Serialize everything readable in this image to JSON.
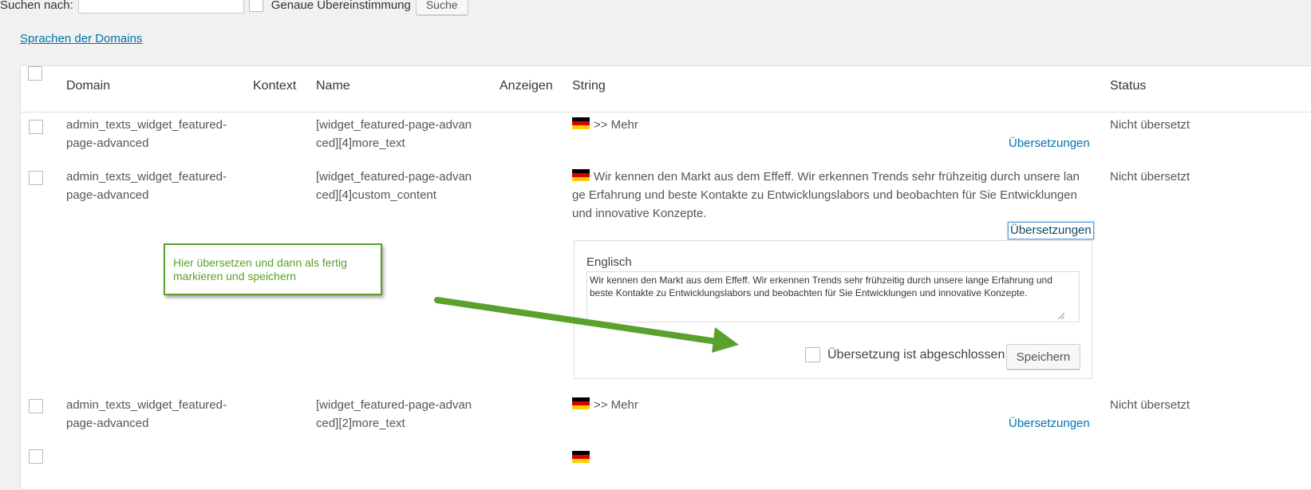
{
  "search": {
    "label": "Suchen nach:",
    "input_value": "",
    "exact_label": "Genaue Übereinstimmung",
    "button_label": "Suche"
  },
  "domain_languages_link": "Sprachen der Domains",
  "table": {
    "headers": {
      "domain": "Domain",
      "context": "Kontext",
      "name": "Name",
      "view": "Anzeigen",
      "string": "String",
      "status": "Status"
    },
    "rows": [
      {
        "domain_line1": "admin_texts_widget_featured-",
        "domain_line2": "page-advanced",
        "name_line1": "[widget_featured-page-advan",
        "name_line2": "ced][4]more_text",
        "string_line1": ">> Mehr",
        "translations_link": "Übersetzungen",
        "status": "Nicht übersetzt"
      },
      {
        "domain_line1": "admin_texts_widget_featured-",
        "domain_line2": "page-advanced",
        "name_line1": "[widget_featured-page-advan",
        "name_line2": "ced][4]custom_content",
        "string_line1": "Wir kennen den Markt aus dem Effeff. Wir erkennen Trends sehr frühzeitig durch unsere lan",
        "string_line2": "ge Erfahrung und beste Kontakte zu Entwicklungslabors und beobachten für Sie Entwicklungen",
        "string_line3": "und innovative Konzepte.",
        "translations_link": "Übersetzungen",
        "status": "Nicht übersetzt"
      },
      {
        "domain_line1": "admin_texts_widget_featured-",
        "domain_line2": "page-advanced",
        "name_line1": "[widget_featured-page-advan",
        "name_line2": "ced][2]more_text",
        "string_line1": ">> Mehr",
        "translations_link": "Übersetzungen",
        "status": "Nicht übersetzt"
      }
    ]
  },
  "editor": {
    "language": "Englisch",
    "text": "Wir kennen den Markt aus dem Effeff. Wir erkennen Trends sehr frühzeitig durch unsere lange Erfahrung und beste Kontakte zu Entwicklungslabors und beobachten für Sie Entwicklungen und innovative Konzepte.",
    "done_label": "Übersetzung ist abgeschlossen",
    "save_label": "Speichern"
  },
  "callout": {
    "line1": "Hier übersetzen und dann als fertig",
    "line2": "markieren und speichern"
  },
  "colors": {
    "link": "#0073aa",
    "annotation_green": "#5aa02c"
  },
  "icons": {
    "flag": "german-flag-icon",
    "resize": "resize-grip-icon",
    "arrow": "green-arrow-icon"
  }
}
